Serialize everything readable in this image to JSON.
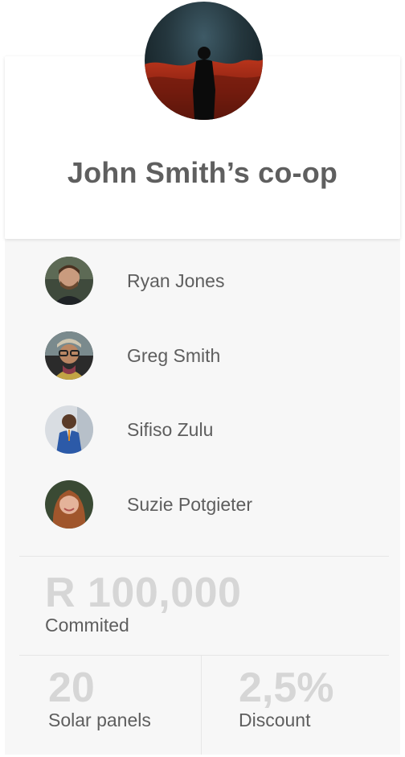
{
  "group": {
    "title": "John Smith’s co-op"
  },
  "members": [
    {
      "name": "Ryan Jones"
    },
    {
      "name": "Greg Smith"
    },
    {
      "name": "Sifiso Zulu"
    },
    {
      "name": "Suzie Potgieter"
    }
  ],
  "commitment": {
    "value": "R 100,000",
    "label": "Commited"
  },
  "stats": {
    "panels_value": "20",
    "panels_label": "Solar panels",
    "discount_value": "2,5%",
    "discount_label": "Discount"
  },
  "colors": {
    "title": "#5f5f5f",
    "text": "#5e5e5e",
    "muted_value": "#d6d6d6",
    "panel_bg": "#f7f7f7"
  }
}
